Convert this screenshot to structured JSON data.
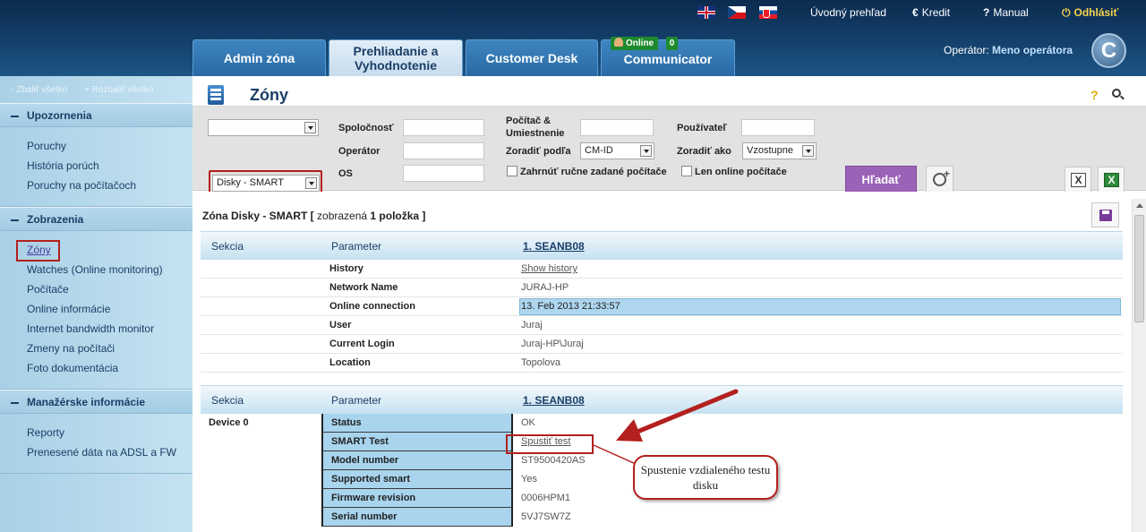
{
  "header": {
    "languages": [
      "English",
      "Čeština",
      "Slovenčina"
    ],
    "links": {
      "home": "Úvodný prehľad",
      "credit": "Kredit",
      "manual": "Manual",
      "logout": "Odhlásiť"
    },
    "tabs": [
      "Admin zóna",
      "Prehliadanie a Vyhodnotenie",
      "Customer Desk",
      "Communicator"
    ],
    "online_label": "Online",
    "online_count": "0",
    "operator_label": "Operátor:",
    "operator_name": "Meno operátora",
    "logo_letter": "C"
  },
  "sidebar": {
    "collapse_all": "- Zbaliť všetko",
    "expand_all": "+ Rozbaliť všetko",
    "sections": [
      {
        "title": "Upozornenia",
        "items": [
          "Poruchy",
          "História porúch",
          "Poruchy na počítačoch"
        ]
      },
      {
        "title": "Zobrazenia",
        "items": [
          "Zóny",
          "Watches (Online monitoring)",
          "Počítače",
          "Online informácie",
          "Internet bandwidth monitor",
          "Zmeny na počítači",
          "Foto dokumentácia"
        ]
      },
      {
        "title": "Manažérske informácie",
        "items": [
          "Reporty",
          "Prenesené dáta na ADSL a FW"
        ]
      }
    ]
  },
  "page_title": "Zóny",
  "filters": {
    "zone_select_top": "",
    "zone_select": "Disky - SMART",
    "spolocnost_label": "Spoločnosť",
    "operator_label": "Operátor",
    "os_label": "OS",
    "pc_label": "Počítač & Umiestnenie",
    "sort_by_label": "Zoradiť podľa",
    "sort_by_value": "CM-ID",
    "user_label": "Používateľ",
    "sort_as_label": "Zoradiť ako",
    "sort_as_value": "Vzostupne",
    "include_manual_label": "Zahrnúť ručne zadané počítače",
    "only_online_label": "Len online počítače",
    "search_button": "Hľadať",
    "export_icons": [
      "xls-export-icon",
      "excel-icon"
    ]
  },
  "results": {
    "summary_prefix": "Zóna Disky - SMART [",
    "summary_mid": " zobrazená ",
    "summary_count": "1",
    "summary_suffix": " položka ]"
  },
  "table1": {
    "headers": [
      "Sekcia",
      "Parameter",
      "1. SEANB08"
    ],
    "rows": [
      {
        "param": "History",
        "value": "Show history"
      },
      {
        "param": "Network Name",
        "value": "JURAJ-HP"
      },
      {
        "param": "Online connection",
        "value": "13. Feb 2013 21:33:57"
      },
      {
        "param": "User",
        "value": "Juraj"
      },
      {
        "param": "Current Login",
        "value": "Juraj-HP\\Juraj"
      },
      {
        "param": "Location",
        "value": "Topolova"
      }
    ]
  },
  "table2": {
    "headers": [
      "Sekcia",
      "Parameter",
      "1. SEANB08"
    ],
    "device": "Device 0",
    "rows": [
      {
        "param": "Status",
        "value": "OK"
      },
      {
        "param": "SMART Test",
        "value": "Spustiť test"
      },
      {
        "param": "Model number",
        "value": "ST9500420AS"
      },
      {
        "param": "Supported smart",
        "value": "Yes"
      },
      {
        "param": "Firmware revision",
        "value": "0006HPM1"
      },
      {
        "param": "Serial number",
        "value": "5VJ7SW7Z"
      }
    ]
  },
  "callout": "Spustenie vzdialeného testu disku",
  "colors": {
    "accent_red": "#b3201d",
    "search_button": "#9b63b8",
    "header_dark": "#0b2b4e"
  }
}
